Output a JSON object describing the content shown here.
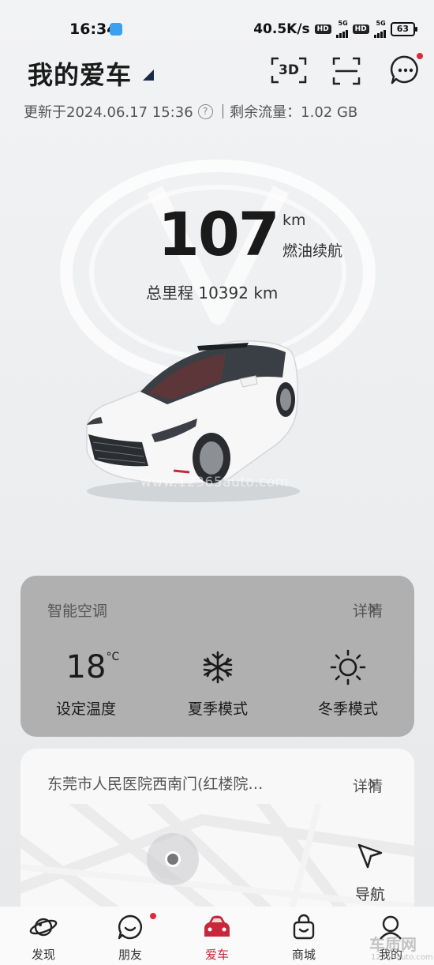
{
  "status_bar": {
    "time": "16:34",
    "network_speed": "40.5K/s",
    "hd_badge_1": "HD",
    "sig_label_1": "5G",
    "hd_badge_2": "HD",
    "sig_label_2": "5G",
    "battery": "63"
  },
  "header": {
    "title": "我的爱车",
    "btn_3d": "3D",
    "update_text": "更新于2024.06.17 15:36",
    "data_remaining": "剩余流量：1.02 GB"
  },
  "vehicle": {
    "range_value": "107",
    "range_unit": "km",
    "range_label": "燃油续航",
    "total_mileage": "总里程 10392 km"
  },
  "ac_card": {
    "title": "智能空调",
    "detail": "详情",
    "temperature": "18",
    "temperature_unit": "°C",
    "items": [
      {
        "label": "设定温度"
      },
      {
        "label": "夏季模式",
        "icon": "snowflake-icon"
      },
      {
        "label": "冬季模式",
        "icon": "sun-icon"
      }
    ]
  },
  "nav_card": {
    "address": "东莞市人民医院西南门(红楼院…",
    "detail": "详情",
    "nav_label": "导航"
  },
  "tabs": [
    {
      "label": "发现",
      "icon": "planet-icon"
    },
    {
      "label": "朋友",
      "icon": "chat-bubble-icon"
    },
    {
      "label": "爱车",
      "icon": "car-icon",
      "active": true
    },
    {
      "label": "商城",
      "icon": "shopping-bag-icon"
    },
    {
      "label": "我的",
      "icon": "user-icon"
    }
  ],
  "watermarks": {
    "middle": "www.12365auto.com",
    "corner": "车质网",
    "corner_url": "12365auto.com"
  },
  "colors": {
    "accent_red": "#c8283a",
    "notification_dot": "#e0283c",
    "ac_card_bg": "#b0b0b0"
  }
}
